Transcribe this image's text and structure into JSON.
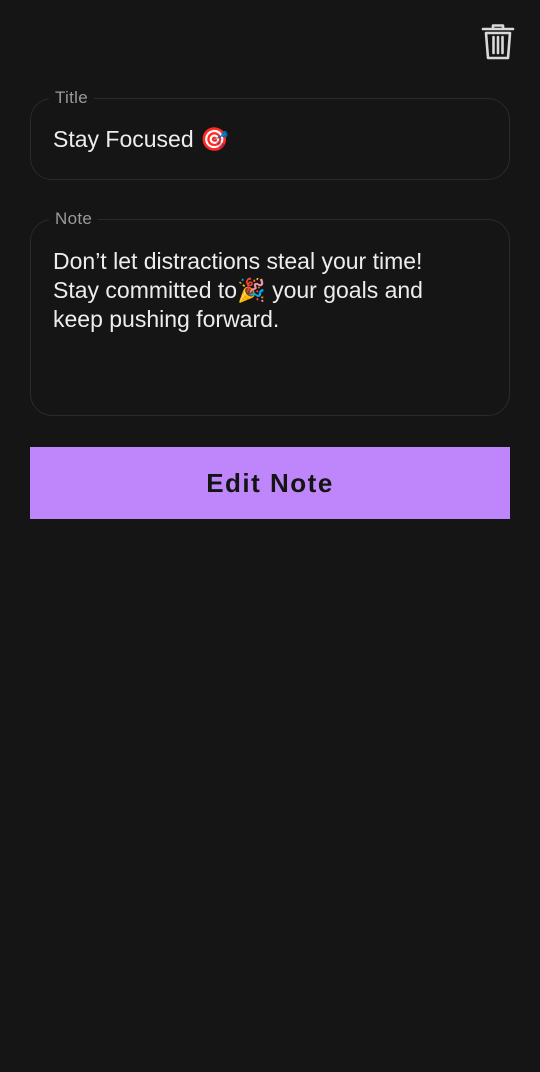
{
  "toolbar": {
    "delete_icon": "trash-icon"
  },
  "form": {
    "title_label": "Title",
    "title_value": "Stay Focused 🎯",
    "note_label": "Note",
    "note_value": "Don’t let distractions steal your time!\nStay committed to🎉 your goals and\nkeep pushing forward."
  },
  "actions": {
    "edit_label": "Edit Note"
  },
  "colors": {
    "background": "#151515",
    "accent": "#bf86fb",
    "border": "#2a2a2a",
    "label": "#9a9a9a",
    "text": "#ededed"
  }
}
